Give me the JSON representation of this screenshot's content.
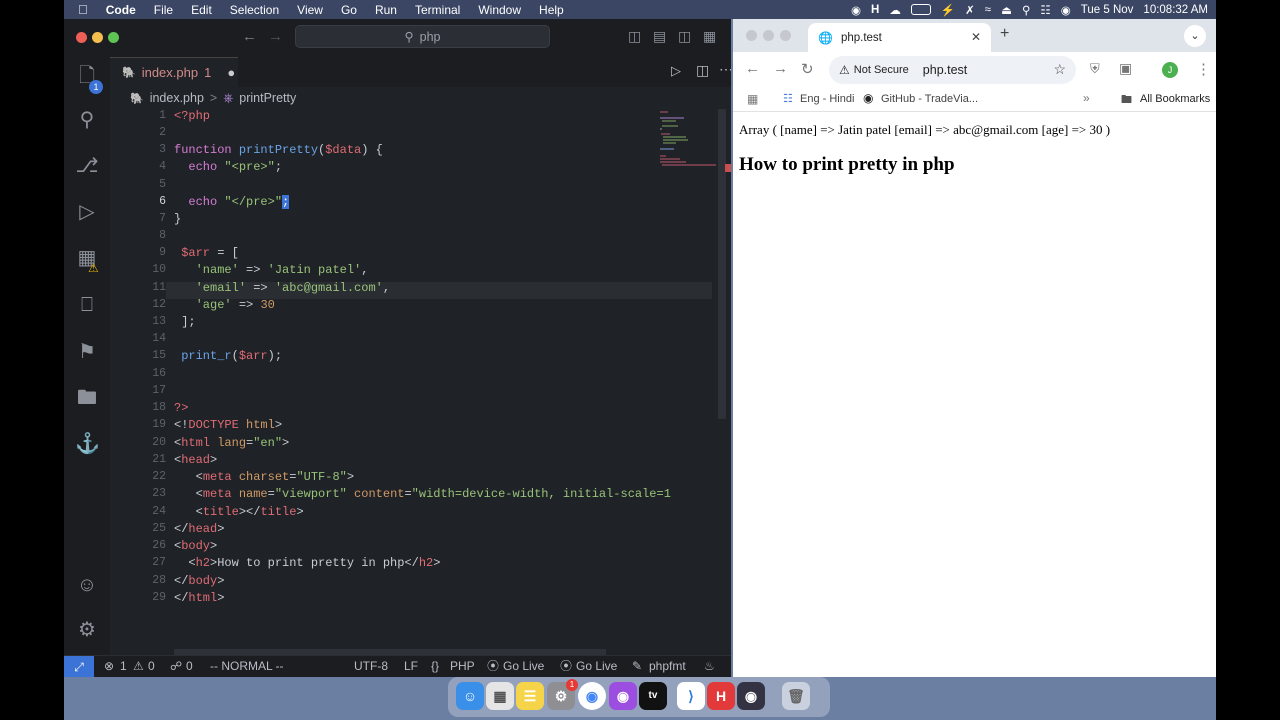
{
  "menubar": {
    "app": "Code",
    "items": [
      "File",
      "Edit",
      "Selection",
      "View",
      "Go",
      "Run",
      "Terminal",
      "Window",
      "Help"
    ],
    "date": "Tue 5 Nov",
    "time": "10:08:32 AM"
  },
  "vscode": {
    "search": "php",
    "tab_name": "index.php",
    "tab_problems": "1",
    "activity_badge": "1",
    "breadcrumb_file": "index.php",
    "breadcrumb_sep": ">",
    "breadcrumb_symbol": "printPretty",
    "status": {
      "errors": "1",
      "warnings": "0",
      "ports": "0",
      "mode": "-- NORMAL --",
      "encoding": "UTF-8",
      "eol": "LF",
      "language": "PHP",
      "golive1": "Go Live",
      "golive2": "Go Live",
      "formatter": "phpfmt"
    },
    "line_numbers": [
      "1",
      "2",
      "3",
      "4",
      "5",
      "6",
      "7",
      "8",
      "9",
      "10",
      "11",
      "12",
      "13",
      "14",
      "15",
      "16",
      "17",
      "18",
      "19",
      "20",
      "21",
      "22",
      "23",
      "24",
      "25",
      "26",
      "27",
      "28",
      "29"
    ],
    "code": {
      "l1": "<?php",
      "l3a": "function",
      "l3b": "printPretty",
      "l3c": "(",
      "l3d": "$data",
      "l3e": ") {",
      "l4a": "echo",
      "l4b": "\"<pre>\"",
      "l4c": ";",
      "l6a": "echo",
      "l6b": "\"</pre>\"",
      "l6c": ";",
      "l7": "}",
      "l9a": "$arr",
      "l9b": " = [",
      "l10a": "'name'",
      "l10b": " => ",
      "l10c": "'Jatin patel'",
      "l10d": ",",
      "l11a": "'email'",
      "l11b": " => ",
      "l11c": "'abc@gmail.com'",
      "l11d": ",",
      "l12a": "'age'",
      "l12b": " => ",
      "l12c": "30",
      "l13": "];",
      "l15a": "print_r",
      "l15b": "(",
      "l15c": "$arr",
      "l15d": ");",
      "l18": "?>",
      "l19a": "<!",
      "l19b": "DOCTYPE",
      "l19c": " html",
      "l19d": ">",
      "l20a": "<",
      "l20b": "html",
      "l20c": " lang",
      "l20d": "=",
      "l20e": "\"en\"",
      "l20f": ">",
      "l21a": "<",
      "l21b": "head",
      "l21c": ">",
      "l22a": "<",
      "l22b": "meta",
      "l22c": " charset",
      "l22d": "=",
      "l22e": "\"UTF-8\"",
      "l22f": ">",
      "l23a": "<",
      "l23b": "meta",
      "l23c": " name",
      "l23d": "=",
      "l23e": "\"viewport\"",
      "l23f": " content",
      "l23g": "=",
      "l23h": "\"width=device-width, initial-scale=1",
      "l24a": "<",
      "l24b": "title",
      "l24c": "></",
      "l24d": "title",
      "l24e": ">",
      "l25a": "</",
      "l25b": "head",
      "l25c": ">",
      "l26a": "<",
      "l26b": "body",
      "l26c": ">",
      "l27a": "<",
      "l27b": "h2",
      "l27c": ">How to print pretty in php</",
      "l27d": "h2",
      "l27e": ">",
      "l28a": "</",
      "l28b": "body",
      "l28c": ">",
      "l29a": "</",
      "l29b": "html",
      "l29c": ">"
    }
  },
  "browser": {
    "tab_title": "php.test",
    "security": "Not Secure",
    "url": "php.test",
    "bookmark1": "Eng - Hindi",
    "bookmark2": "GitHub - TradeVia...",
    "all_bookmarks": "All Bookmarks",
    "profile_initial": "J",
    "output_line": "Array ( [name] => Jatin patel [email] => abc@gmail.com [age] => 30 )",
    "heading": "How to print pretty in php"
  },
  "dock": {
    "badge": "1"
  }
}
